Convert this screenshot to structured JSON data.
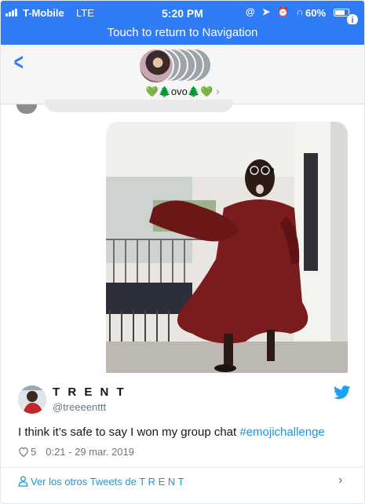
{
  "status_bar": {
    "carrier": "T-Mobile",
    "network": "LTE",
    "time": "5:20 PM",
    "status_icons": "@ ➤ ⏰ ∩",
    "battery": "60%",
    "info_badge": "i"
  },
  "return_bar": {
    "label": "Touch to return to Navigation"
  },
  "conversation": {
    "back_icon": "chevron-left-icon",
    "group_name": "💚🌲ovo🌲💚",
    "group_chevron": "›"
  },
  "tweet": {
    "author_name": "T R E N T",
    "author_handle": "@treeeenttt",
    "text_before": "I think it’s safe to say I won my group chat ",
    "hashtag": "#emojichallenge",
    "likes": "5",
    "timestamp": "0:21 - 29 mar. 2019"
  },
  "footer": {
    "link_label": "Ver los otros Tweets de T R E N T",
    "chevron": "›"
  },
  "colors": {
    "ios_blue": "#2f7cf6",
    "twitter_blue": "#1b95e0",
    "robe_red": "#7a1c1e",
    "meta_gray": "#657786"
  }
}
